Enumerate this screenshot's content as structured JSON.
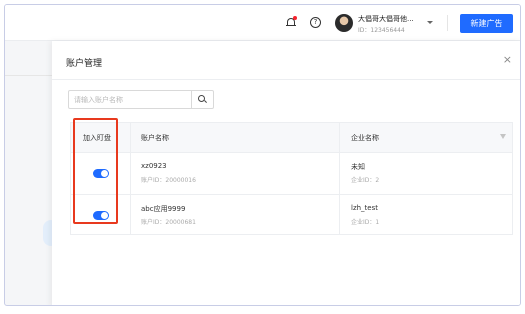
{
  "header": {
    "user_name": "大倡哥大倡哥他...",
    "user_id": "ID：123456444",
    "new_ad_label": "新建广告",
    "help_glyph": "?"
  },
  "drawer": {
    "title": "账户管理",
    "close_glyph": "×",
    "search_placeholder": "请输入账户名称"
  },
  "table": {
    "columns": [
      "加入盯盘",
      "账户名称",
      "企业名称"
    ],
    "rows": [
      {
        "pinned": true,
        "account_name": "xz0923",
        "account_id": "账户ID：20000016",
        "company_name": "未知",
        "company_id": "企业ID：2"
      },
      {
        "pinned": true,
        "account_name": "abc应用9999",
        "account_id": "账户ID：20000681",
        "company_name": "lzh_test",
        "company_id": "企业ID：1"
      }
    ]
  },
  "colors": {
    "primary": "#1f6bff",
    "highlight": "#e8391e"
  }
}
